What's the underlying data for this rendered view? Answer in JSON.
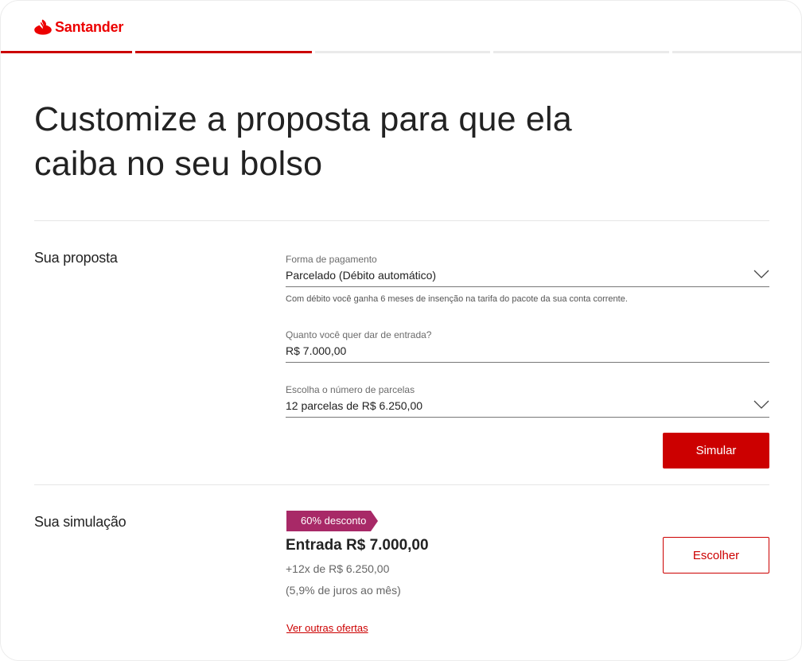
{
  "brand": {
    "name": "Santander",
    "accent_color": "#ec0000",
    "logo_icon": "flame-icon"
  },
  "progress": {
    "total_steps": 5,
    "completed_steps": 2
  },
  "title": "Customize a proposta para que ela caiba no seu bolso",
  "proposal": {
    "section_title": "Sua proposta",
    "payment_method": {
      "label": "Forma de pagamento",
      "value": "Parcelado (Débito automático)",
      "helper": "Com débito você ganha 6 meses de insenção na tarifa do pacote da sua conta corrente."
    },
    "down_payment": {
      "label": "Quanto você quer dar de entrada?",
      "value": "R$ 7.000,00"
    },
    "installments": {
      "label": "Escolha o número de parcelas",
      "value": "12 parcelas de R$ 6.250,00"
    },
    "simulate_label": "Simular"
  },
  "simulation": {
    "section_title": "Sua simulação",
    "badge": "60% desconto",
    "entry": "Entrada R$ 7.000,00",
    "installments": "+12x de R$ 6.250,00",
    "interest": "(5,9%  de juros ao mês)",
    "choose_label": "Escolher",
    "other_offers_link": "Ver outras ofertas"
  },
  "colors": {
    "primary": "#cc0000",
    "badge": "#a82967",
    "divider": "#e6e6e6"
  }
}
